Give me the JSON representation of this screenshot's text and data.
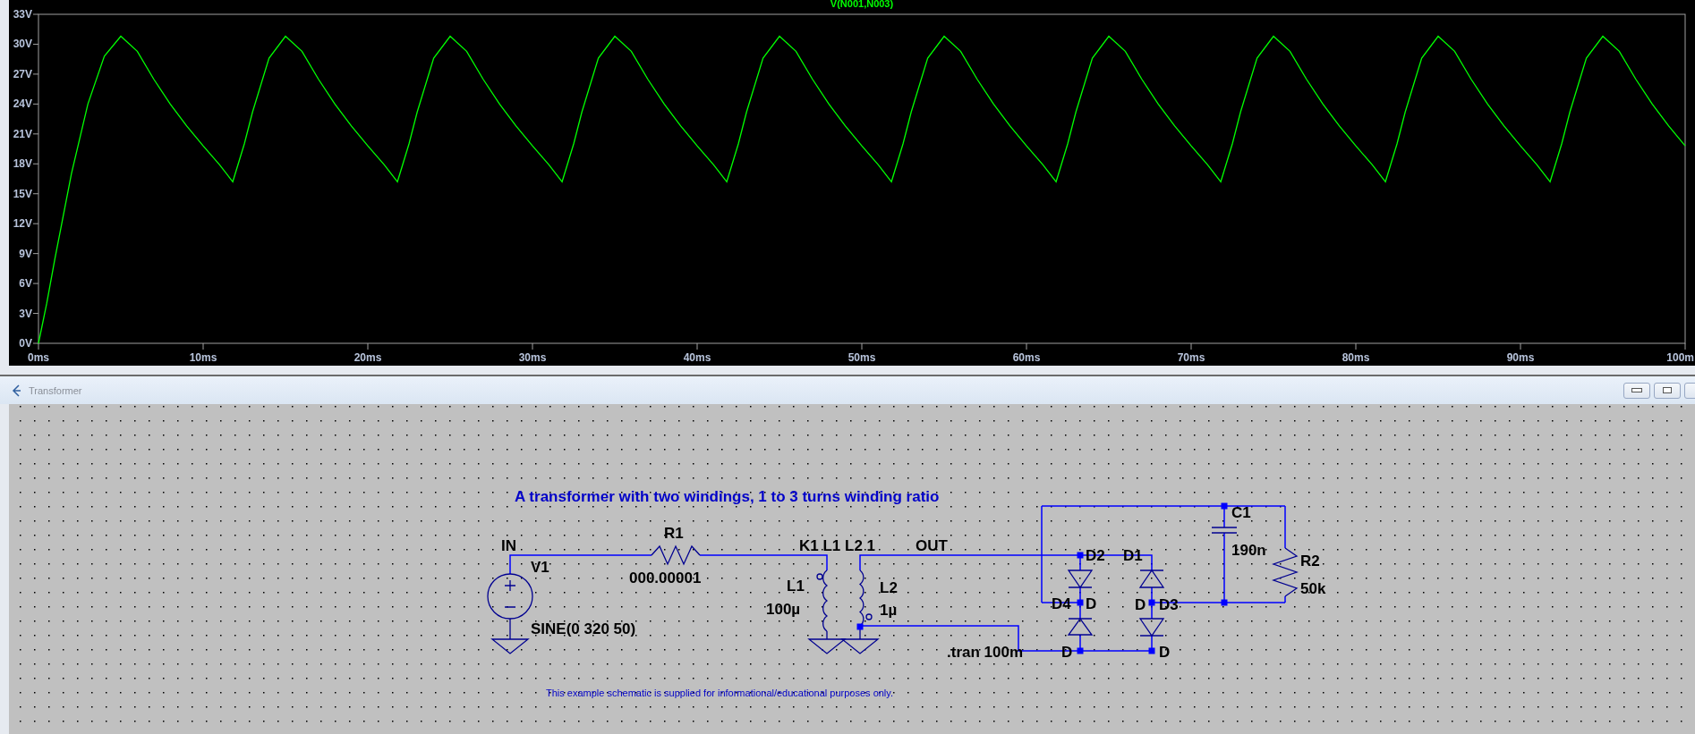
{
  "plot": {
    "chart_data": {
      "type": "line",
      "title": "V(N001,N003)",
      "x": [
        0,
        0.5,
        1,
        2,
        3,
        4,
        5,
        6,
        7,
        8,
        9,
        10,
        11,
        11.8,
        12.5,
        13,
        14,
        15,
        16,
        17,
        18,
        19,
        20,
        21,
        21.8,
        22.5,
        23,
        24,
        25,
        26,
        27,
        28,
        29,
        30,
        31,
        31.8,
        32.5,
        33,
        34,
        35,
        36,
        37,
        38,
        39,
        40,
        41,
        41.8,
        42.5,
        43,
        44,
        45,
        46,
        47,
        48,
        49,
        50,
        51,
        51.8,
        52.5,
        53,
        54,
        55,
        56,
        57,
        58,
        59,
        60,
        61,
        61.8,
        62.5,
        63,
        64,
        65,
        66,
        67,
        68,
        69,
        70,
        71,
        71.8,
        72.5,
        73,
        74,
        75,
        76,
        77,
        78,
        79,
        80,
        81,
        81.8,
        82.5,
        83,
        84,
        85,
        86,
        87,
        88,
        89,
        90,
        91,
        91.8,
        92.5,
        93,
        94,
        95,
        96,
        97,
        98,
        99,
        100
      ],
      "series": [
        {
          "color": "#00ff00",
          "values": [
            0,
            4,
            8.5,
            17,
            24,
            28.8,
            30.8,
            29.3,
            26.5,
            24,
            21.8,
            19.8,
            17.9,
            16.2,
            20,
            23.2,
            28.6,
            30.8,
            29.3,
            26.5,
            24,
            21.8,
            19.8,
            17.9,
            16.2,
            20,
            23.2,
            28.6,
            30.8,
            29.3,
            26.5,
            24,
            21.8,
            19.8,
            17.9,
            16.2,
            20,
            23.2,
            28.6,
            30.8,
            29.3,
            26.5,
            24,
            21.8,
            19.8,
            17.9,
            16.2,
            20,
            23.2,
            28.6,
            30.8,
            29.3,
            26.5,
            24,
            21.8,
            19.8,
            17.9,
            16.2,
            20,
            23.2,
            28.6,
            30.8,
            29.3,
            26.5,
            24,
            21.8,
            19.8,
            17.9,
            16.2,
            20,
            23.2,
            28.6,
            30.8,
            29.3,
            26.5,
            24,
            21.8,
            19.8,
            17.9,
            16.2,
            20,
            23.2,
            28.6,
            30.8,
            29.3,
            26.5,
            24,
            21.8,
            19.8,
            17.9,
            16.2,
            20,
            23.2,
            28.6,
            30.8,
            29.3,
            26.5,
            24,
            21.8,
            19.8,
            17.9,
            16.2,
            20,
            23.2,
            28.6,
            30.8,
            29.3,
            26.5,
            24,
            21.8,
            19.8
          ]
        }
      ],
      "xlim": [
        0,
        100
      ],
      "ylim": [
        0,
        33
      ],
      "xticks": [
        {
          "value": 0,
          "label": "0ms"
        },
        {
          "value": 10,
          "label": "10ms"
        },
        {
          "value": 20,
          "label": "20ms"
        },
        {
          "value": 30,
          "label": "30ms"
        },
        {
          "value": 40,
          "label": "40ms"
        },
        {
          "value": 50,
          "label": "50ms"
        },
        {
          "value": 60,
          "label": "60ms"
        },
        {
          "value": 70,
          "label": "70ms"
        },
        {
          "value": 80,
          "label": "80ms"
        },
        {
          "value": 90,
          "label": "90ms"
        },
        {
          "value": 100,
          "label": "100m"
        }
      ],
      "yticks": [
        {
          "value": 0,
          "label": "0V"
        },
        {
          "value": 3,
          "label": "3V"
        },
        {
          "value": 6,
          "label": "6V"
        },
        {
          "value": 9,
          "label": "9V"
        },
        {
          "value": 12,
          "label": "12V"
        },
        {
          "value": 15,
          "label": "15V"
        },
        {
          "value": 18,
          "label": "18V"
        },
        {
          "value": 21,
          "label": "21V"
        },
        {
          "value": 24,
          "label": "24V"
        },
        {
          "value": 27,
          "label": "27V"
        },
        {
          "value": 30,
          "label": "30V"
        },
        {
          "value": 33,
          "label": "33V"
        }
      ]
    }
  },
  "schematic_window": {
    "title": "Transformer"
  },
  "schematic": {
    "comment": "A transformer with two windings, 1 to 3 turns winding ratio",
    "net_labels": [
      "IN",
      "OUT"
    ],
    "components": [
      {
        "kind": "voltage_source",
        "ref": "V1",
        "value": "SINE(0 320 50)"
      },
      {
        "kind": "resistor",
        "ref": "R1",
        "value": "000.00001"
      },
      {
        "kind": "inductor",
        "ref": "L1",
        "value": "100µ"
      },
      {
        "kind": "inductor",
        "ref": "L2",
        "value": "1µ"
      },
      {
        "kind": "diode",
        "ref": "D2",
        "value": "D"
      },
      {
        "kind": "diode",
        "ref": "D1",
        "value": "D"
      },
      {
        "kind": "diode",
        "ref": "D4",
        "value": "D"
      },
      {
        "kind": "diode",
        "ref": "D3",
        "value": "D"
      },
      {
        "kind": "capacitor",
        "ref": "C1",
        "value": "190n"
      },
      {
        "kind": "resistor",
        "ref": "R2",
        "value": "50k"
      }
    ],
    "directives": [
      "K1 L1 L2 1",
      ".tran 100m"
    ],
    "note": "This example schematic is supplied for informational/educational purposes only."
  }
}
